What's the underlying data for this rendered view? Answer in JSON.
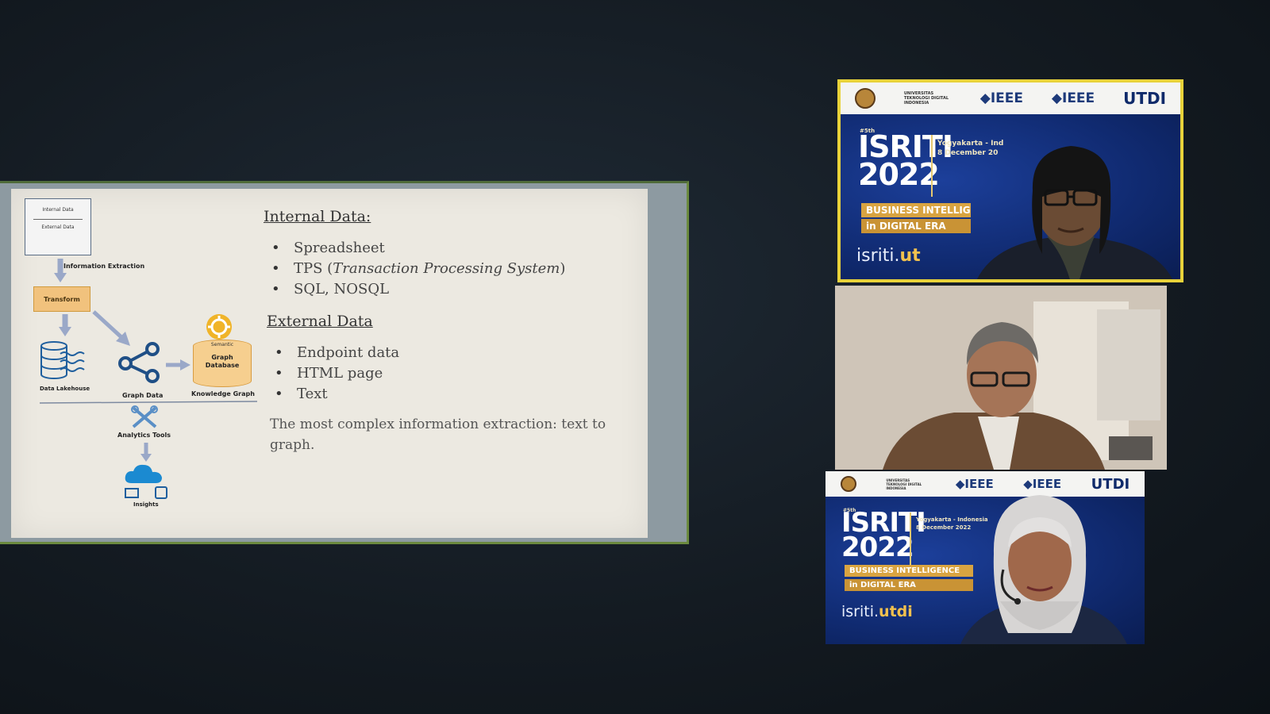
{
  "slide": {
    "diagram": {
      "source_top": "Internal Data",
      "source_bottom": "External Data",
      "extraction": "Information Extraction",
      "transform": "Transform",
      "lakehouse": "Data Lakehouse",
      "graph_data": "Graph Data",
      "semantic": "Semantic",
      "graph_db": "Graph Database",
      "knowledge_graph": "Knowledge Graph",
      "analytics": "Analytics Tools",
      "insights": "Insights"
    },
    "internal_heading": "Internal Data:",
    "internal_items": [
      "Spreadsheet",
      "TPS (",
      "Transaction Processing System",
      ")",
      "SQL, NOSQL"
    ],
    "external_heading": "External Data",
    "external_items": [
      "Endpoint data",
      "HTML page",
      "Text"
    ],
    "note": "The most complex information extraction: text to graph."
  },
  "tiles": {
    "brand": {
      "ieee1": "◆IEEE",
      "ieee2": "◆IEEE",
      "utdi": "UTDI",
      "univ": "UNIVERSITAS TEKNOLOGI DIGITAL INDONESIA"
    },
    "event": {
      "edition": "#5th",
      "name": "ISRITI",
      "year": "2022",
      "location_top": "Yogyakarta - Ind",
      "date_top": "8 December 20",
      "location_bottom": "Yogyakarta - Indonesia",
      "date_bottom": "8 December 2022",
      "theme1_top": "BUSINESS INTELLIGE",
      "theme1_bottom": "BUSINESS INTELLIGENCE",
      "theme2": "in DIGITAL ERA",
      "site_prefix": "isriti.",
      "site_top_suffix": "ut",
      "site_bottom_suffix": "utdi"
    }
  },
  "colors": {
    "brand_blue": "#1d3a7a",
    "banner_gold": "#d9a441",
    "active_speaker_border": "#e8d23a",
    "slide_bg": "#ece9e1"
  }
}
